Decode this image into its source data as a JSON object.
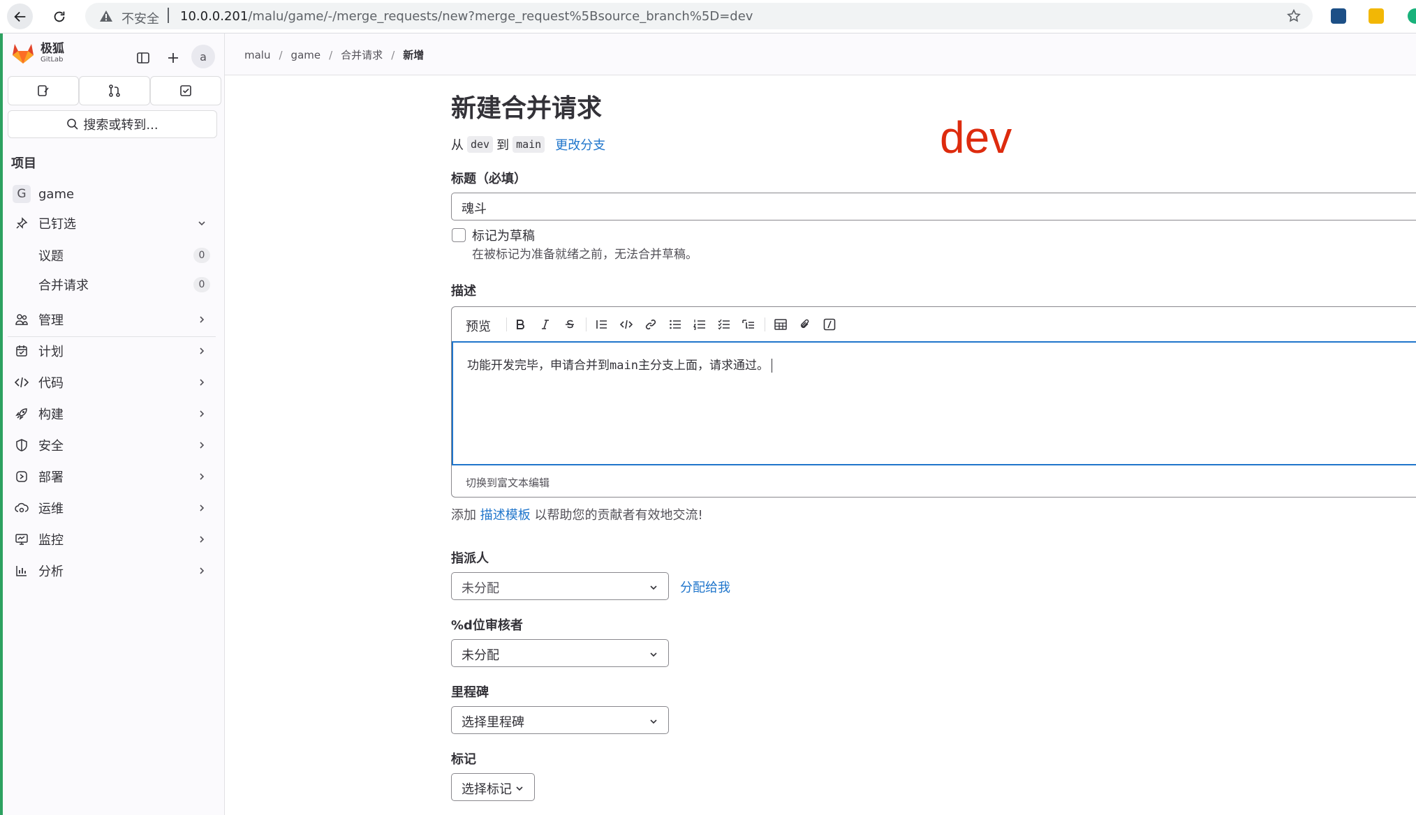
{
  "browser": {
    "insecure_label": "不安全",
    "url_host": "10.0.0.201",
    "url_path": "/malu/game/-/merge_requests/new?merge_request%5Bsource_branch%5D=dev"
  },
  "sidebar": {
    "brand_name": "极狐",
    "brand_sub": "GitLab",
    "avatar_alt": "a",
    "search_label": "搜索或转到...",
    "section_heading": "项目",
    "project": {
      "badge": "G",
      "name": "game"
    },
    "pinned": {
      "label": "已钉选",
      "items": [
        {
          "label": "议题",
          "count": "0"
        },
        {
          "label": "合并请求",
          "count": "0"
        }
      ]
    },
    "nav": [
      {
        "label": "管理",
        "icon": "users-icon"
      },
      {
        "label": "计划",
        "icon": "calendar-icon"
      },
      {
        "label": "代码",
        "icon": "code-icon"
      },
      {
        "label": "构建",
        "icon": "rocket-icon"
      },
      {
        "label": "安全",
        "icon": "shield-icon"
      },
      {
        "label": "部署",
        "icon": "deployments-icon"
      },
      {
        "label": "运维",
        "icon": "cloud-gear-icon"
      },
      {
        "label": "监控",
        "icon": "monitor-icon"
      },
      {
        "label": "分析",
        "icon": "chart-icon"
      }
    ]
  },
  "breadcrumb": [
    "malu",
    "game",
    "合并请求",
    "新增"
  ],
  "main": {
    "title": "新建合并请求",
    "from_word": "从",
    "source_branch": "dev",
    "to_word": "到",
    "target_branch": "main",
    "change_branches": "更改分支",
    "annotation": "dev",
    "title_label": "标题（必填）",
    "title_value": "魂斗",
    "draft_label": "标记为草稿",
    "draft_help": "在被标记为准备就绪之前，无法合并草稿。",
    "description_label": "描述",
    "preview_tab": "预览",
    "description_value": "功能开发完毕，申请合并到main主分支上面，请求通过。",
    "rich_text_toggle": "切换到富文本编辑",
    "help_prefix": "添加",
    "help_link": "描述模板",
    "help_suffix": "以帮助您的贡献者有效地交流!",
    "assignee_label": "指派人",
    "assignee_value": "未分配",
    "assign_to_me": "分配给我",
    "reviewer_label": "%d位审核者",
    "reviewer_value": "未分配",
    "milestone_label": "里程碑",
    "milestone_value": "选择里程碑",
    "labels_label": "标记",
    "labels_value": "选择标记"
  },
  "colors": {
    "link": "#1f75cb",
    "annotation": "#dd2b0e",
    "focus": "#1f75cb",
    "sidebar_edge": "#2da160"
  }
}
